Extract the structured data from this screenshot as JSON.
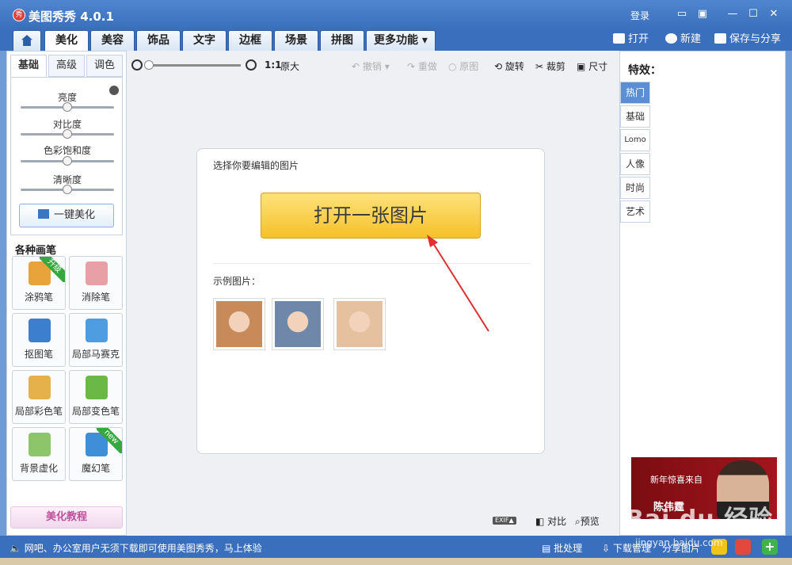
{
  "window": {
    "title": "美图秀秀 4.0.1",
    "logo_char": "秀",
    "login": "登录",
    "controls": [
      "▭",
      "▣",
      "—",
      "☐",
      "✕"
    ]
  },
  "nav": {
    "tabs": [
      "美化",
      "美容",
      "饰品",
      "文字",
      "边框",
      "场景",
      "拼图",
      "更多功能 ▾"
    ],
    "active": "美化",
    "actions": {
      "open": "打开",
      "new": "新建",
      "save_share": "保存与分享"
    }
  },
  "left_panel": {
    "subtabs": [
      "基础",
      "高级",
      "调色"
    ],
    "sliders": [
      {
        "label": "亮度",
        "value": 0.5
      },
      {
        "label": "对比度",
        "value": 0.5
      },
      {
        "label": "色彩饱和度",
        "value": 0.5
      },
      {
        "label": "清晰度",
        "value": 0.5
      }
    ],
    "auto_beautify": "一键美化",
    "brushes_title": "各种画笔",
    "tools": [
      {
        "label": "涂鸦笔",
        "icon": "pencil-icon",
        "badge": "升级",
        "color": "#e8a33a"
      },
      {
        "label": "消除笔",
        "icon": "eraser-icon",
        "badge": "",
        "color": "#e7a0a6"
      },
      {
        "label": "抠图笔",
        "icon": "cutout-pen-icon",
        "badge": "",
        "color": "#3d7fcf"
      },
      {
        "label": "局部马赛克",
        "icon": "mosaic-icon",
        "badge": "",
        "color": "#4d9de0"
      },
      {
        "label": "局部彩色笔",
        "icon": "color-brush-icon",
        "badge": "",
        "color": "#e5b14a"
      },
      {
        "label": "局部变色笔",
        "icon": "recolor-pen-icon",
        "badge": "",
        "color": "#6cb847"
      },
      {
        "label": "背景虚化",
        "icon": "blur-background-icon",
        "badge": "",
        "color": "#8cc56a"
      },
      {
        "label": "魔幻笔",
        "icon": "magic-pen-icon",
        "badge": "new",
        "color": "#3e8ed8"
      }
    ],
    "tutorial": "美化教程"
  },
  "toolbar": {
    "zoom_value": 0.0,
    "actual_size": "1:1",
    "original_size": "原大",
    "undo": "撤销",
    "redo": "重做",
    "original": "原图",
    "rotate": "旋转",
    "crop": "裁剪",
    "resize": "尺寸"
  },
  "card": {
    "hint": "选择你要编辑的图片",
    "open_button": "打开一张图片",
    "samples_label": "示例图片：",
    "samples": [
      {
        "name": "sample-woman-bangs",
        "color": "#c98a5a"
      },
      {
        "name": "sample-woman-denim",
        "color": "#6f87a8"
      },
      {
        "name": "sample-baby",
        "color": "#e6c1a0"
      }
    ]
  },
  "bottom_tools": {
    "exif": "EXIF▲",
    "compare": "对比",
    "preview": "预览"
  },
  "right_panel": {
    "title": "特效：",
    "tabs": [
      "热门",
      "基础",
      "Lomo",
      "人像",
      "时尚",
      "艺术"
    ],
    "active": "热门",
    "ad_line1": "新年惊喜来自",
    "ad_line2": "陈伟霆"
  },
  "statusbar": {
    "message": "网吧、办公室用户无须下载即可使用美图秀秀，马上体验",
    "batch": "批处理",
    "download_manager": "下载管理",
    "share_images": "分享图片"
  },
  "watermark": {
    "brand": "Bai du 经验",
    "url": "jingyan.baidu.com"
  },
  "colors": {
    "accent": "#3a6fbd",
    "open_button": "#f6c12a",
    "active_effect": "#5b8fd3"
  }
}
